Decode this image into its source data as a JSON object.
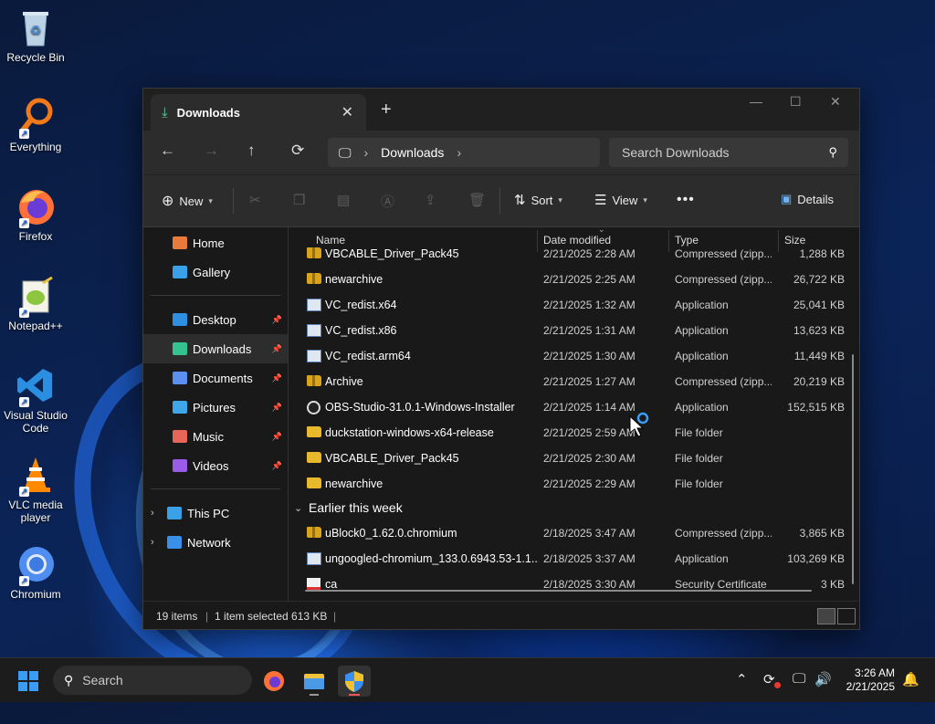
{
  "desktop": {
    "icons": [
      {
        "label": "Recycle Bin"
      },
      {
        "label": "Everything"
      },
      {
        "label": "Firefox"
      },
      {
        "label": "Notepad++"
      },
      {
        "label": "Visual Studio Code"
      },
      {
        "label": "VLC media player"
      },
      {
        "label": "Chromium"
      }
    ]
  },
  "window": {
    "tab_title": "Downloads",
    "address": {
      "crumb": "Downloads"
    },
    "search": {
      "placeholder": "Search Downloads"
    },
    "toolbar": {
      "new_label": "New",
      "sort_label": "Sort",
      "view_label": "View",
      "details_label": "Details"
    },
    "sidebar": {
      "top": [
        {
          "label": "Home",
          "color": "#e87a3b"
        },
        {
          "label": "Gallery",
          "color": "#3aa0e8"
        }
      ],
      "quick": [
        {
          "label": "Desktop",
          "color": "#2f8fe0"
        },
        {
          "label": "Downloads",
          "color": "#34c38f"
        },
        {
          "label": "Documents",
          "color": "#5b8ff0"
        },
        {
          "label": "Pictures",
          "color": "#3fa6e8"
        },
        {
          "label": "Music",
          "color": "#e8655a"
        },
        {
          "label": "Videos",
          "color": "#9a5ce8"
        }
      ],
      "bottom": [
        {
          "label": "This PC",
          "color": "#3aa0e8"
        },
        {
          "label": "Network",
          "color": "#3a8fe8"
        }
      ]
    },
    "columns": {
      "name": "Name",
      "date": "Date modified",
      "type": "Type",
      "size": "Size"
    },
    "rows_top": [
      {
        "name": "VBCABLE_Driver_Pack45",
        "date": "2/21/2025 2:28 AM",
        "type": "Compressed (zipp...",
        "size": "1,288 KB",
        "kind": "zip"
      },
      {
        "name": "newarchive",
        "date": "2/21/2025 2:25 AM",
        "type": "Compressed (zipp...",
        "size": "26,722 KB",
        "kind": "zip"
      },
      {
        "name": "VC_redist.x64",
        "date": "2/21/2025 1:32 AM",
        "type": "Application",
        "size": "25,041 KB",
        "kind": "app"
      },
      {
        "name": "VC_redist.x86",
        "date": "2/21/2025 1:31 AM",
        "type": "Application",
        "size": "13,623 KB",
        "kind": "app"
      },
      {
        "name": "VC_redist.arm64",
        "date": "2/21/2025 1:30 AM",
        "type": "Application",
        "size": "11,449 KB",
        "kind": "app"
      },
      {
        "name": "Archive",
        "date": "2/21/2025 1:27 AM",
        "type": "Compressed (zipp...",
        "size": "20,219 KB",
        "kind": "zip"
      },
      {
        "name": "OBS-Studio-31.0.1-Windows-Installer",
        "date": "2/21/2025 1:14 AM",
        "type": "Application",
        "size": "152,515 KB",
        "kind": "obs"
      },
      {
        "name": "duckstation-windows-x64-release",
        "date": "2/21/2025 2:59 AM",
        "type": "File folder",
        "size": "",
        "kind": "folder"
      },
      {
        "name": "VBCABLE_Driver_Pack45",
        "date": "2/21/2025 2:30 AM",
        "type": "File folder",
        "size": "",
        "kind": "folder"
      },
      {
        "name": "newarchive",
        "date": "2/21/2025 2:29 AM",
        "type": "File folder",
        "size": "",
        "kind": "folder"
      }
    ],
    "group_label": "Earlier this week",
    "rows_bottom": [
      {
        "name": "uBlock0_1.62.0.chromium",
        "date": "2/18/2025 3:47 AM",
        "type": "Compressed (zipp...",
        "size": "3,865 KB",
        "kind": "zip"
      },
      {
        "name": "ungoogled-chromium_133.0.6943.53-1.1...",
        "date": "2/18/2025 3:37 AM",
        "type": "Application",
        "size": "103,269 KB",
        "kind": "app"
      },
      {
        "name": "ca",
        "date": "2/18/2025 3:30 AM",
        "type": "Security Certificate",
        "size": "3 KB",
        "kind": "cert"
      }
    ],
    "status": {
      "items": "19 items",
      "selected": "1 item selected  613 KB"
    }
  },
  "taskbar": {
    "search_label": "Search",
    "time": "3:26 AM",
    "date": "2/21/2025"
  }
}
